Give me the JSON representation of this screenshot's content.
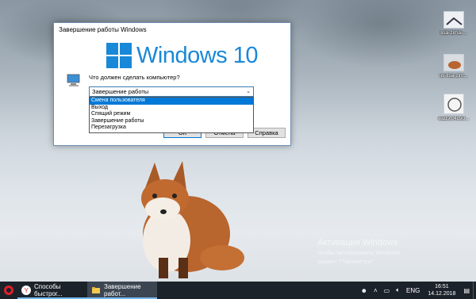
{
  "dialog": {
    "title": "Завершение работы Windows",
    "logo_text": "Windows 10",
    "question": "Что должен сделать компьютер?",
    "selected": "Завершение работы",
    "options": [
      "Смена пользователя",
      "Выход",
      "Спящий режим",
      "Завершение работы",
      "Перезагрузка"
    ],
    "buttons": {
      "ok": "ОК",
      "cancel": "Отмена",
      "help": "Справка"
    }
  },
  "desktop_icons": [
    {
      "label": "lisa-zima-..."
    },
    {
      "label": "lis-lisa-zim..."
    },
    {
      "label": "ead9fc4c90..."
    }
  ],
  "watermark": {
    "title": "Активация Windows",
    "line1": "Чтобы активировать Windows,",
    "line2": "раздел \"Параметры\""
  },
  "taskbar": {
    "items": [
      {
        "label": "Способы быстрог..."
      },
      {
        "label": "Завершение работ..."
      }
    ],
    "language": "ENG",
    "time": "16:51",
    "date": "14.12.2018"
  },
  "colors": {
    "accent": "#0078d7",
    "windows_blue": "#1a88d8",
    "taskbar": "#1c2229"
  }
}
